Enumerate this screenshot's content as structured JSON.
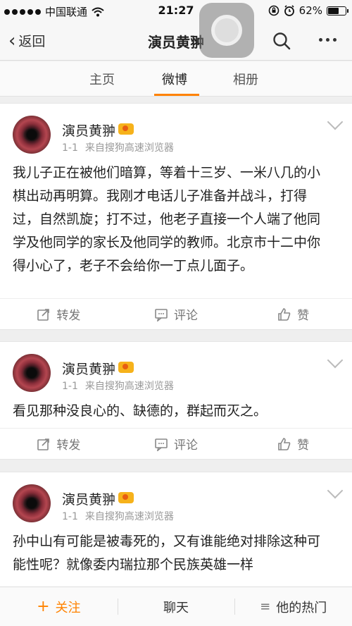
{
  "status_bar": {
    "carrier": "中国联通",
    "time": "21:27",
    "battery_percent": "62%",
    "battery_level": 0.62
  },
  "nav": {
    "back_label": "返回",
    "title": "演员黄翀"
  },
  "tabs": [
    {
      "label": "主页",
      "active": false
    },
    {
      "label": "微博",
      "active": true
    },
    {
      "label": "相册",
      "active": false
    }
  ],
  "posts": [
    {
      "author": "演员黄翀",
      "date": "1-1",
      "source": "来自搜狗高速浏览器",
      "content": "我儿子正在被他们暗算，等着十三岁、一米八几的小棋出动再明算。我刚才电话儿子准备并战斗，打得过，自然凯旋；打不过，他老子直接一个人端了他同学及他同学的家长及他同学的教师。北京市十二中你得小心了，老子不会给你一丁点儿面子。"
    },
    {
      "author": "演员黄翀",
      "date": "1-1",
      "source": "来自搜狗高速浏览器",
      "content": "看见那种没良心的、缺德的，群起而灭之。"
    },
    {
      "author": "演员黄翀",
      "date": "1-1",
      "source": "来自搜狗高速浏览器",
      "content": "孙中山有可能是被毒死的，又有谁能绝对排除这种可能性呢？就像委内瑞拉那个民族英雄一样"
    }
  ],
  "actions": {
    "repost": "转发",
    "comment": "评论",
    "like": "赞"
  },
  "bottom_bar": {
    "follow": "关注",
    "chat": "聊天",
    "hot": "他的热门"
  },
  "colors": {
    "accent": "#ff8200"
  }
}
